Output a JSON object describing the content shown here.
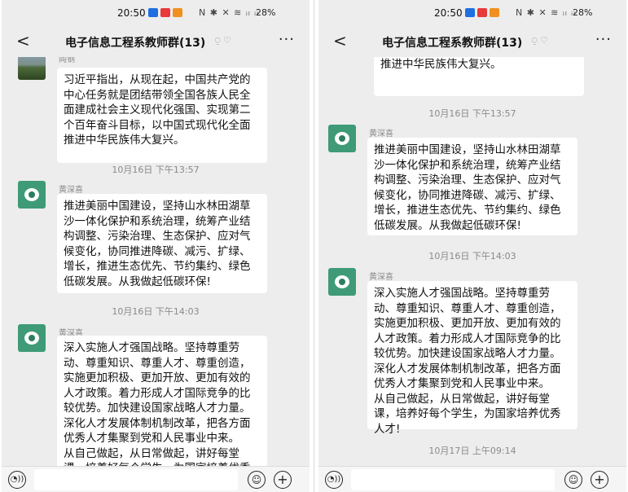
{
  "status_bar": {
    "time": "20:50",
    "system_icons": "N ✱ ✕ ≋ ᵢₗ ᵢₗ",
    "battery": "28%"
  },
  "header": {
    "back": "<",
    "title": "电子信息工程系教师群(13)",
    "mute_icons": "⍜ ♡",
    "more": "···"
  },
  "messages": {
    "m1": {
      "sender": "阎钢",
      "text": "习近平指出，从现在起，中国共产党的中心任务就是团结带领全国各族人民全面建成社会主义现代化强国、实现第二个百年奋斗目标，以中国式现代化全面推进中华民族伟大复兴。"
    },
    "ts1": "10月16日 下午13:57",
    "m2": {
      "sender": "黄深喜",
      "text": "推进美丽中国建设，坚持山水林田湖草沙一体化保护和系统治理，统筹产业结构调整、污染治理、生态保护、应对气候变化，协同推进降碳、减污、扩绿、增长，推进生态优先、节约集约、绿色低碳发展。从我做起低碳环保!"
    },
    "ts2": "10月16日 下午14:03",
    "m3": {
      "sender": "黄深喜",
      "text_p1": "深入实施人才强国战略。坚持尊重劳动、尊重知识、尊重人才、尊重创造，实施更加积极、更加开放、更加有效的人才政策。着力形成人才国际竞争的比较优势。加快建设国家战略人才力量。深化人才发展体制机制改革，把各方面优秀人才集聚到党和人民事业中来。",
      "text_p2": "从自己做起，从日常做起，讲好每堂课，培养好每个学生，为国家培养优秀人才!"
    },
    "ts3": "10月17日 上午09:14"
  },
  "input_bar": {
    "voice": "◔))",
    "emoji": "☺",
    "plus": "+"
  },
  "colors": {
    "background": "#ededed",
    "bubble": "#ffffff",
    "avatar": "#3f9a78"
  }
}
